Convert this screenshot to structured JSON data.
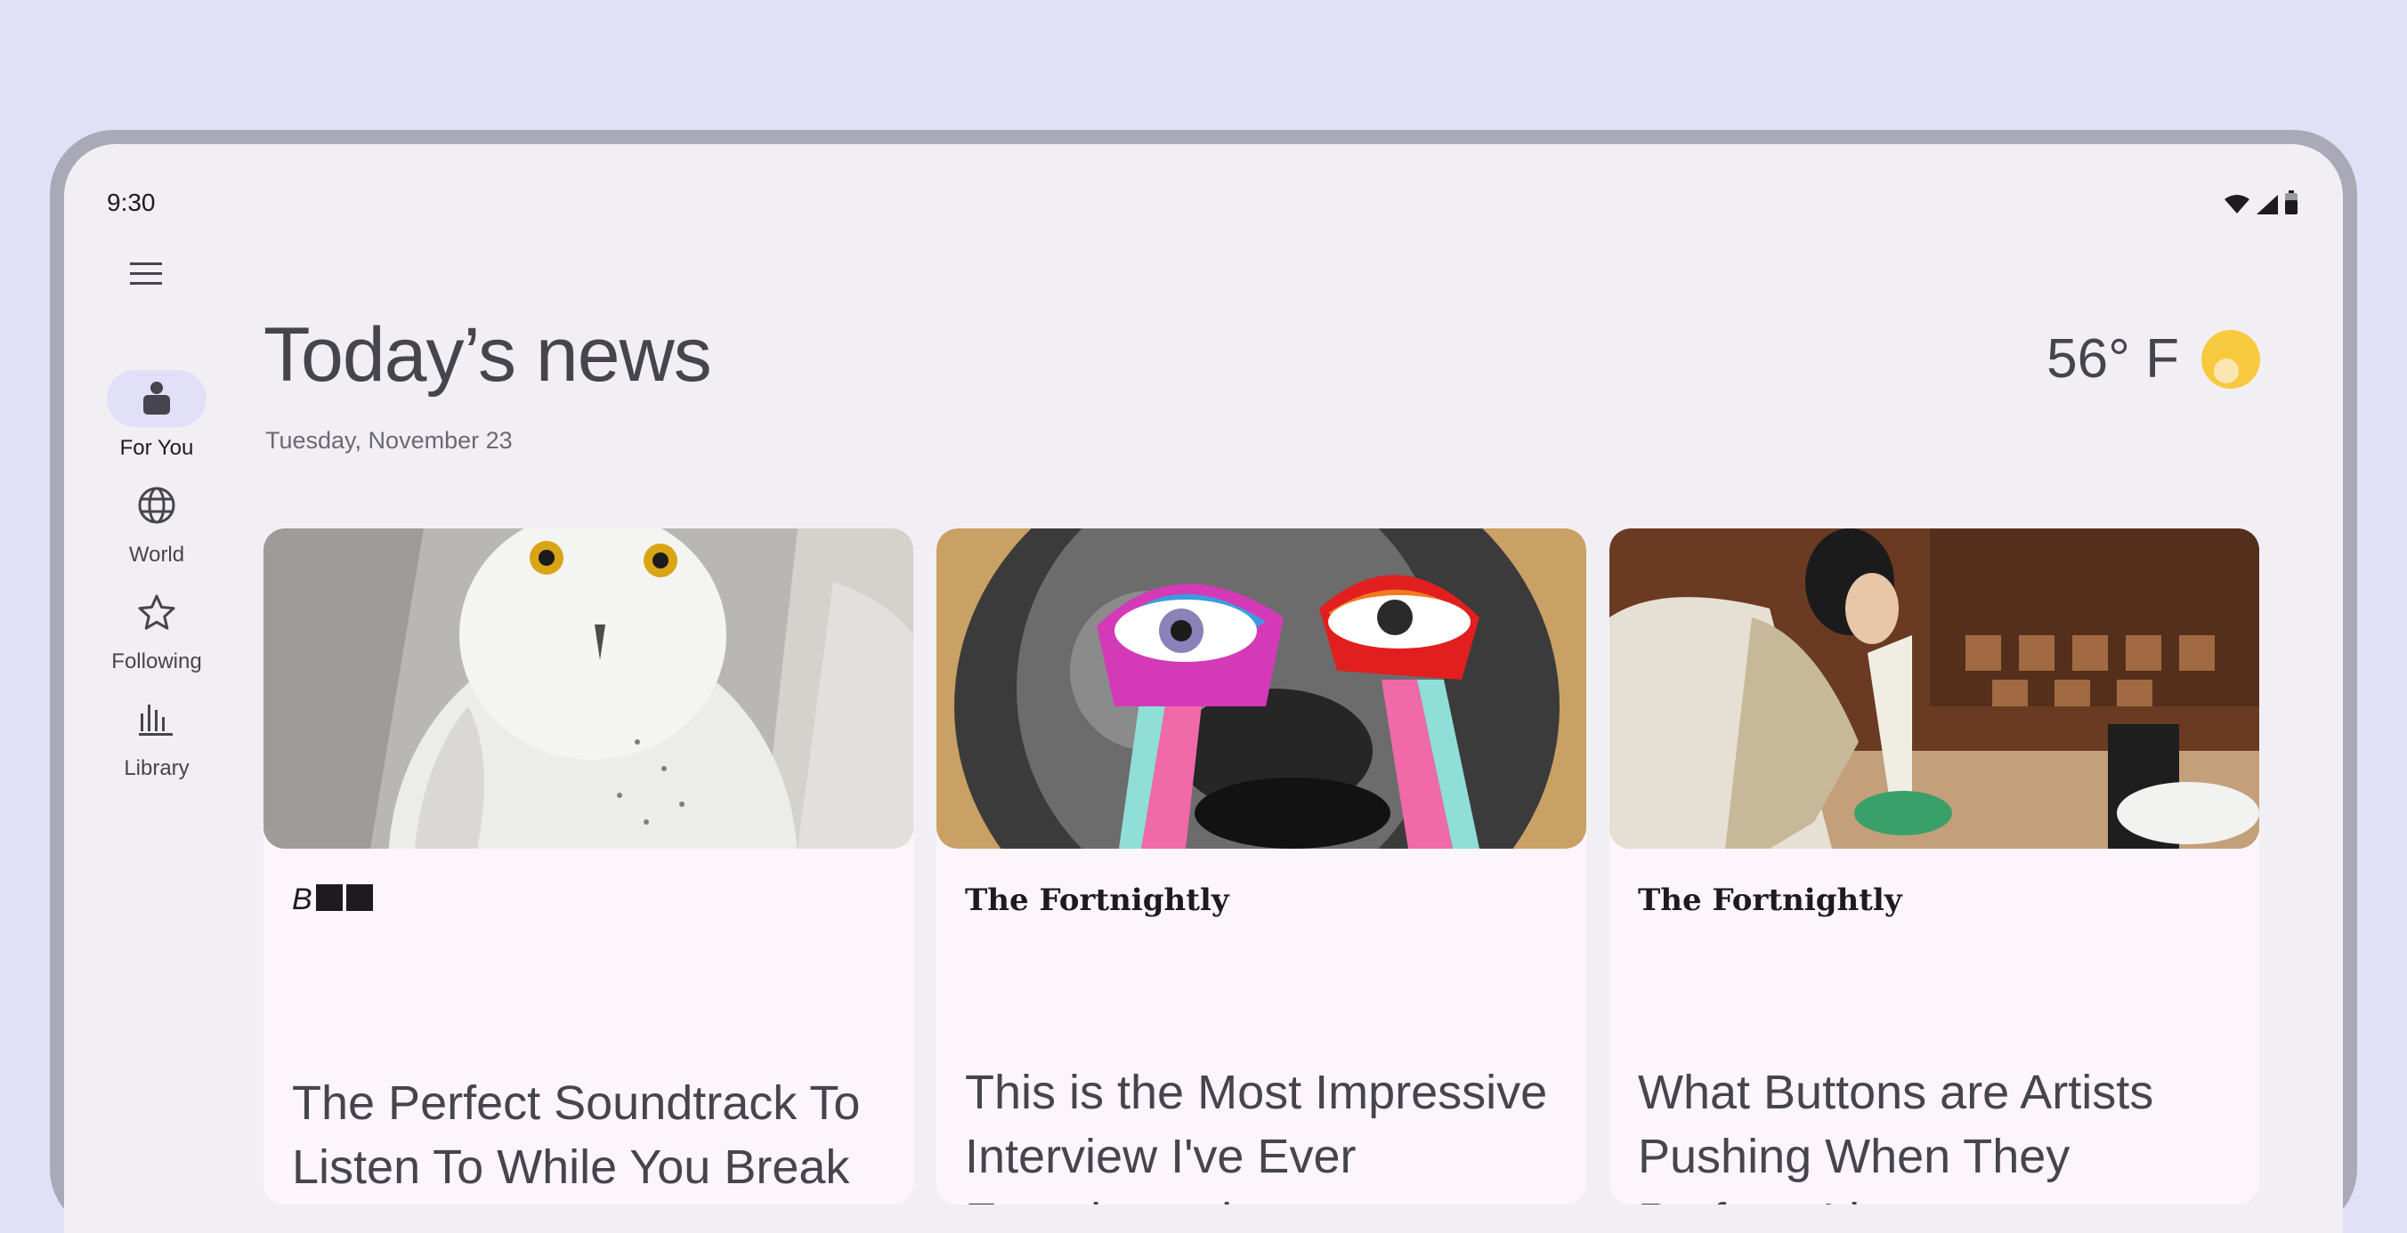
{
  "status_bar": {
    "time": "9:30",
    "icons": [
      "wifi-icon",
      "signal-icon",
      "battery-icon"
    ]
  },
  "nav": {
    "menu_icon": "menu-icon",
    "items": [
      {
        "label": "For You",
        "icon": "for-you-icon",
        "active": true
      },
      {
        "label": "World",
        "icon": "globe-icon",
        "active": false
      },
      {
        "label": "Following",
        "icon": "star-icon",
        "active": false
      },
      {
        "label": "Library",
        "icon": "library-icon",
        "active": false
      }
    ]
  },
  "header": {
    "title": "Today’s news",
    "date": "Tuesday, November 23"
  },
  "weather": {
    "temperature": "56° F",
    "icon": "sun-icon"
  },
  "articles": [
    {
      "source": "B",
      "title": "The Perfect Soundtrack To Listen To While You Break Unhealthy Habits",
      "image": "snowy-owl"
    },
    {
      "source": "The Fortnightly",
      "title": "This is the Most Impressive Interview I've Ever Experienced",
      "image": "collage-face-with-eyes"
    },
    {
      "source": "The Fortnightly",
      "title": "What Buttons are Artists Pushing When They Perform Live",
      "image": "woman-piping-pastry"
    }
  ],
  "colors": {
    "background": "#e2e0f6",
    "surface": "#f2eff4",
    "card": "#fcf5fc",
    "active_indicator": "#e2dff8",
    "text_primary": "#46444d"
  }
}
